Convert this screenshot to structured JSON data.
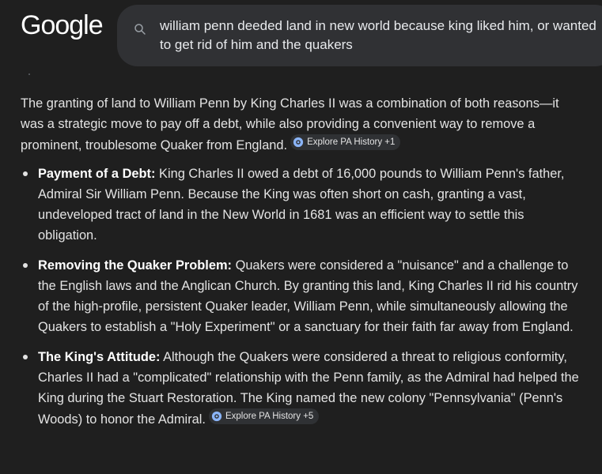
{
  "header": {
    "logo_text": "Google",
    "search_query": "william penn deeded land in new world because king liked him, or wanted to get rid of him and the quakers"
  },
  "answer": {
    "intro": "The granting of land to William Penn by King Charles II was a combination of both reasons—it was a strategic move to pay off a debt, while also providing a convenient way to remove a prominent, troublesome Quaker from England.",
    "intro_chip": "Explore PA History +1",
    "bullets": [
      {
        "title": "Payment of a Debt:",
        "text": " King Charles II owed a debt of 16,000 pounds to William Penn's father, Admiral Sir William Penn. Because the King was often short on cash, granting a vast, undeveloped tract of land in the New World in 1681 was an efficient way to settle this obligation."
      },
      {
        "title": "Removing the Quaker Problem:",
        "text": " Quakers were considered a \"nuisance\" and a challenge to the English laws and the Anglican Church. By granting this land, King Charles II rid his country of the high-profile, persistent Quaker leader, William Penn, while simultaneously allowing the Quakers to establish a \"Holy Experiment\" or a sanctuary for their faith far away from England."
      },
      {
        "title": "The King's Attitude:",
        "text": " Although the Quakers were considered a threat to religious conformity, Charles II had a \"complicated\" relationship with the Penn family, as the Admiral had helped the King during the Stuart Restoration. The King named the new colony \"Pennsylvania\" (Penn's Woods) to honor the Admiral.",
        "chip": "Explore PA History +5"
      }
    ]
  },
  "colors": {
    "background": "#1f1f1f",
    "search_box": "#303134",
    "text": "#e3e3e3",
    "chip_bg": "#2f3134"
  }
}
